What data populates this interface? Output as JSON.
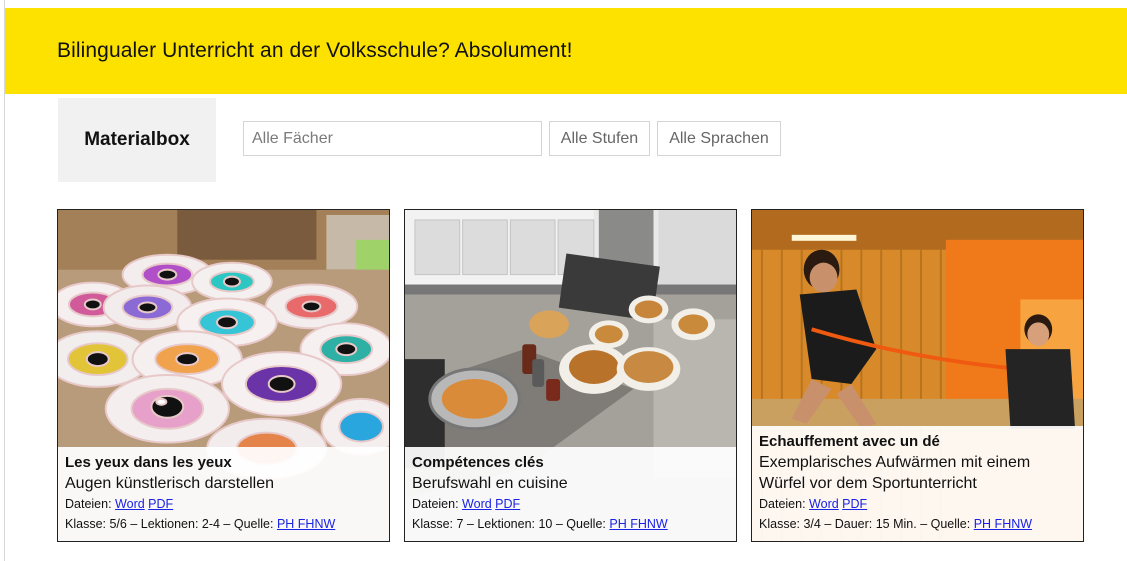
{
  "banner": {
    "title": "Bilingualer Unterricht an der Volksschule? Absolument!"
  },
  "brand": {
    "title": "Materialbox"
  },
  "filters": {
    "subjects_placeholder": "Alle Fächer",
    "levels_label": "Alle Stufen",
    "languages_label": "Alle Sprachen"
  },
  "cards": [
    {
      "title": "Les yeux dans les yeux",
      "subtitle": "Augen künstlerisch darstellen",
      "files_label": "Dateien:",
      "file_word": "Word",
      "file_pdf": "PDF",
      "meta": "Klasse: 5/6 – Lektionen: 2-4 – Quelle:",
      "source": "PH FHNW",
      "image": "painted-eyeballs-photo"
    },
    {
      "title": "Compétences clés",
      "subtitle": "Berufswahl en cuisine",
      "files_label": "Dateien:",
      "file_word": "Word",
      "file_pdf": "PDF",
      "meta": "Klasse: 7 – Lektionen: 10 – Quelle:",
      "source": "PH FHNW",
      "image": "kitchen-pancakes-photo"
    },
    {
      "title": "Echauffement avec un dé",
      "subtitle": "Exemplarisches Aufwärmen mit einem Würfel vor dem Sportunterricht",
      "files_label": "Dateien:",
      "file_word": "Word",
      "file_pdf": "PDF",
      "meta": "Klasse: 3/4 – Dauer: 15 Min. – Quelle:",
      "source": "PH FHNW",
      "image": "gym-jumping-photo"
    }
  ]
}
